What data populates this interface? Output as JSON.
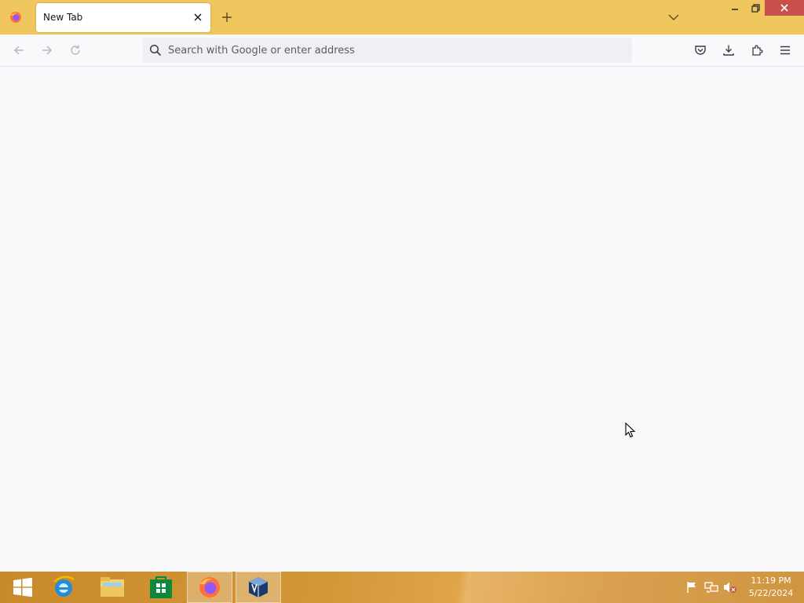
{
  "browser": {
    "tab": {
      "title": "New Tab"
    },
    "urlbar": {
      "placeholder": "Search with Google or enter address",
      "value": ""
    }
  },
  "colors": {
    "titlebar": "#f0c75e",
    "close_button": "#c7504b",
    "content_bg": "#f9f9fb",
    "urlbar_bg": "#f0f0f4"
  },
  "icons": {
    "toolbar": [
      "back-icon",
      "forward-icon",
      "reload-icon",
      "pocket-icon",
      "downloads-icon",
      "extensions-icon",
      "menu-icon"
    ],
    "taskbar": [
      "windows-start-icon",
      "internet-explorer-icon",
      "file-explorer-icon",
      "store-icon",
      "firefox-icon",
      "virtualbox-icon"
    ],
    "tray": [
      "action-center-flag-icon",
      "network-icon",
      "volume-muted-icon"
    ]
  },
  "taskbar": {
    "clock": {
      "time": "11:19 PM",
      "date": "5/22/2024"
    }
  }
}
